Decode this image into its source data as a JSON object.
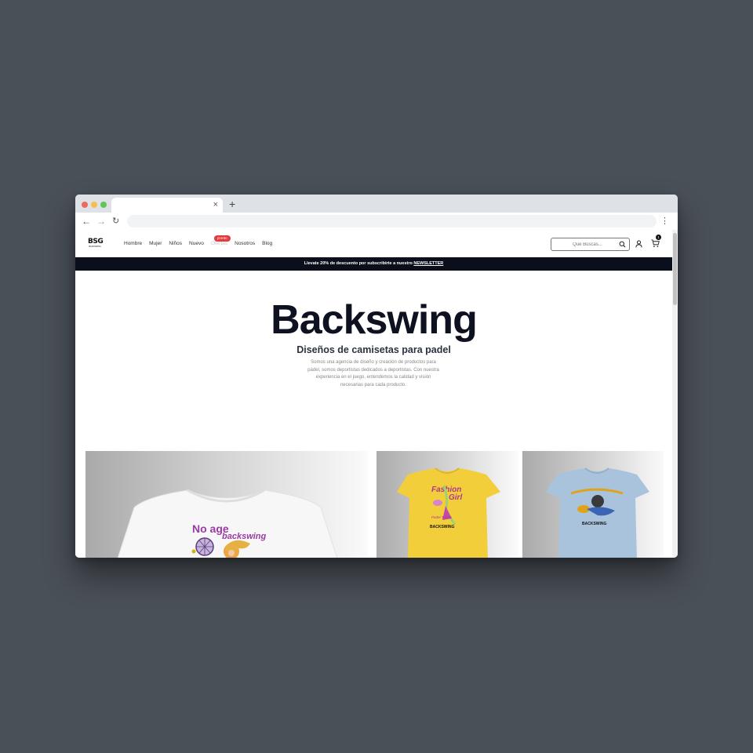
{
  "browser": {
    "tab_close": "×",
    "new_tab": "+",
    "back": "←",
    "forward": "→",
    "reload": "↻",
    "menu": "⋮"
  },
  "site": {
    "logo_mark": "BSG",
    "logo_sub": "BACKSWING",
    "nav": [
      {
        "label": "Hombre"
      },
      {
        "label": "Mujer"
      },
      {
        "label": "Niños"
      },
      {
        "label": "Nuevo"
      },
      {
        "label": "Ofertas",
        "badge": "pronto"
      },
      {
        "label": "Nosotros"
      },
      {
        "label": "Blog"
      }
    ],
    "search_placeholder": "Que Buscas...",
    "cart_count": "1"
  },
  "promo": {
    "text": "Llevate 20% de descuento por subscribirte a nuestro ",
    "link": "NEWSLETTER"
  },
  "hero": {
    "title": "Backswing",
    "subtitle": "Diseños de camisetas para padel",
    "description": "Somos una agencia de diseño y creación de productos para pádel, somos deportistas dedicados a deportistas. Con nuestra experiencia en el juego, entendemos la calidad y visión necesarias para cada producto."
  },
  "products": [
    {
      "shirt_color": "#f7f7f7",
      "print_text_1": "No age",
      "print_text_2": "backswing",
      "print_color": "#9c3aa6"
    },
    {
      "shirt_color": "#f2cf3a",
      "print_text_1": "Fashion",
      "print_text_2": "Girl",
      "print_text_3": "Padel Tennis",
      "print_brand": "BACKSWING",
      "print_color": "#b0378f"
    },
    {
      "shirt_color": "#a9c3dc",
      "print_brand": "BACKSWING",
      "print_color": "#e0a318"
    }
  ],
  "colors": {
    "page_bg": "#4a5058",
    "promo_bg": "#0b0f1c",
    "hero_title": "#0d1120",
    "badge": "#e33b3b"
  }
}
